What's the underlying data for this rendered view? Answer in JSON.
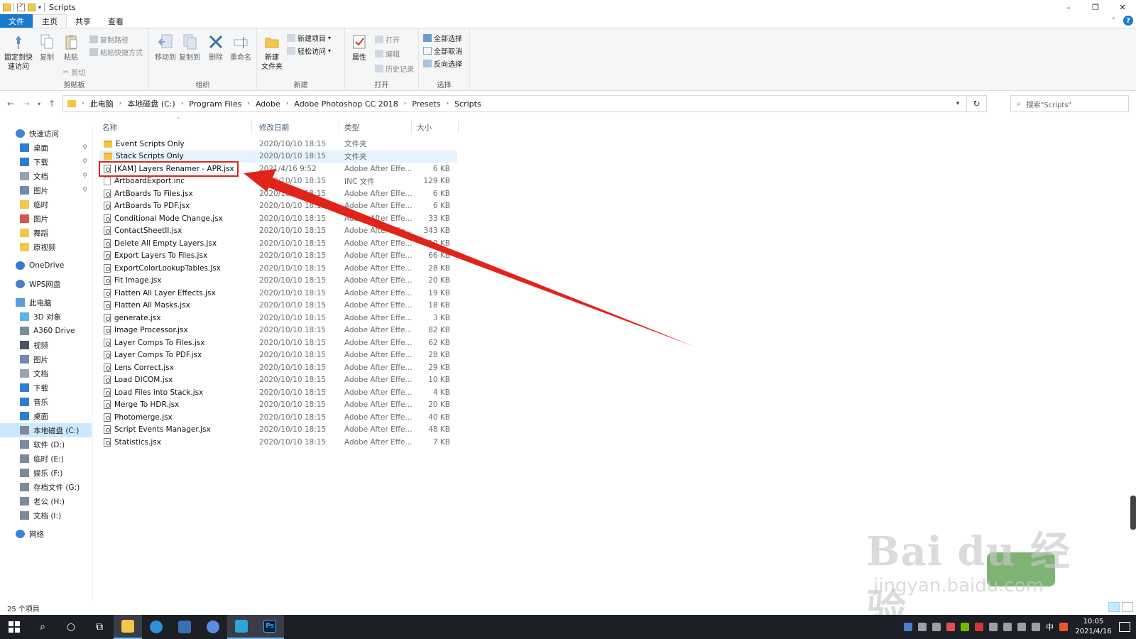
{
  "window": {
    "title": "Scripts",
    "controls": [
      "–",
      "❐",
      "✕"
    ]
  },
  "ribbon_tabs": [
    "文件",
    "主页",
    "共享",
    "查看"
  ],
  "ribbon": {
    "clipboard": {
      "label": "剪贴板",
      "pin": "固定到快速访问",
      "copy": "复制",
      "paste": "粘贴",
      "copy_path": "复制路径",
      "paste_shortcut": "粘贴快捷方式",
      "cut": "剪切"
    },
    "organize": {
      "label": "组织",
      "move_to": "移动到",
      "copy_to": "复制到",
      "delete": "删除",
      "rename": "重命名"
    },
    "new": {
      "label": "新建",
      "new_folder": "新建\n文件夹",
      "new_item": "新建项目",
      "easy_access": "轻松访问"
    },
    "open": {
      "label": "打开",
      "properties": "属性",
      "open": "打开",
      "edit": "编辑",
      "history": "历史记录"
    },
    "select": {
      "label": "选择",
      "select_all": "全部选择",
      "select_none": "全部取消",
      "invert": "反向选择"
    }
  },
  "breadcrumb": [
    "此电脑",
    "本地磁盘 (C:)",
    "Program Files",
    "Adobe",
    "Adobe Photoshop CC 2018",
    "Presets",
    "Scripts"
  ],
  "search": {
    "placeholder": "搜索\"Scripts\""
  },
  "sidebar": [
    {
      "label": "快速访问",
      "icon": "star-icon",
      "level": 0
    },
    {
      "label": "桌面",
      "icon": "desktop-icon",
      "level": 1,
      "pinned": true
    },
    {
      "label": "下载",
      "icon": "download-icon",
      "level": 1,
      "pinned": true
    },
    {
      "label": "文档",
      "icon": "document-icon",
      "level": 1,
      "pinned": true
    },
    {
      "label": "图片",
      "icon": "pictures-icon",
      "level": 1,
      "pinned": true
    },
    {
      "label": "临时",
      "icon": "folder-icon",
      "level": 1
    },
    {
      "label": "图片",
      "icon": "photos-app-icon",
      "level": 1
    },
    {
      "label": "舞蹈",
      "icon": "folder-icon",
      "level": 1
    },
    {
      "label": "原视频",
      "icon": "folder-icon",
      "level": 1
    },
    {
      "label": "OneDrive",
      "icon": "cloud-icon",
      "level": 0
    },
    {
      "label": "WPS网盘",
      "icon": "wps-cloud-icon",
      "level": 0
    },
    {
      "label": "此电脑",
      "icon": "computer-icon",
      "level": 0
    },
    {
      "label": "3D 对象",
      "icon": "cube-icon",
      "level": 1
    },
    {
      "label": "A360 Drive",
      "icon": "cloud-drive-icon",
      "level": 1
    },
    {
      "label": "视频",
      "icon": "video-icon",
      "level": 1
    },
    {
      "label": "图片",
      "icon": "pictures-icon",
      "level": 1
    },
    {
      "label": "文档",
      "icon": "document-icon",
      "level": 1
    },
    {
      "label": "下载",
      "icon": "download-icon",
      "level": 1
    },
    {
      "label": "音乐",
      "icon": "music-icon",
      "level": 1
    },
    {
      "label": "桌面",
      "icon": "desktop-icon",
      "level": 1
    },
    {
      "label": "本地磁盘 (C:)",
      "icon": "system-drive-icon",
      "level": 1,
      "selected": true
    },
    {
      "label": "软件 (D:)",
      "icon": "drive-icon",
      "level": 1
    },
    {
      "label": "临时 (E:)",
      "icon": "drive-icon",
      "level": 1
    },
    {
      "label": "娱乐 (F:)",
      "icon": "drive-icon",
      "level": 1
    },
    {
      "label": "存档文件 (G:)",
      "icon": "drive-icon",
      "level": 1
    },
    {
      "label": "老公 (H:)",
      "icon": "drive-icon",
      "level": 1
    },
    {
      "label": "文档 (I:)",
      "icon": "drive-icon",
      "level": 1
    },
    {
      "label": "网络",
      "icon": "network-icon",
      "level": 0
    }
  ],
  "columns": {
    "name": "名称",
    "date": "修改日期",
    "type": "类型",
    "size": "大小"
  },
  "files": [
    {
      "name": "Event Scripts Only",
      "date": "2020/10/10 18:15",
      "type": "文件夹",
      "size": "",
      "kind": "folder"
    },
    {
      "name": "Stack Scripts Only",
      "date": "2020/10/10 18:15",
      "type": "文件夹",
      "size": "",
      "kind": "folder"
    },
    {
      "name": "[KAM] Layers Renamer - APR.jsx",
      "date": "2021/4/16 9:52",
      "type": "Adobe After Effe...",
      "size": "6 KB",
      "kind": "jsx"
    },
    {
      "name": "ArtboardExport.inc",
      "date": "2020/10/10 18:15",
      "type": "INC 文件",
      "size": "129 KB",
      "kind": "blank"
    },
    {
      "name": "ArtBoards To Files.jsx",
      "date": "2020/10/10 18:15",
      "type": "Adobe After Effe...",
      "size": "6 KB",
      "kind": "jsx"
    },
    {
      "name": "ArtBoards To PDF.jsx",
      "date": "2020/10/10 18:15",
      "type": "Adobe After Effe...",
      "size": "6 KB",
      "kind": "jsx"
    },
    {
      "name": "Conditional Mode Change.jsx",
      "date": "2020/10/10 18:15",
      "type": "Adobe After Effe...",
      "size": "33 KB",
      "kind": "jsx"
    },
    {
      "name": "ContactSheetII.jsx",
      "date": "2020/10/10 18:15",
      "type": "Adobe After Effe...",
      "size": "343 KB",
      "kind": "jsx"
    },
    {
      "name": "Delete All Empty Layers.jsx",
      "date": "2020/10/10 18:15",
      "type": "Adobe After Effe...",
      "size": "10 KB",
      "kind": "jsx"
    },
    {
      "name": "Export Layers To Files.jsx",
      "date": "2020/10/10 18:15",
      "type": "Adobe After Effe...",
      "size": "66 KB",
      "kind": "jsx"
    },
    {
      "name": "ExportColorLookupTables.jsx",
      "date": "2020/10/10 18:15",
      "type": "Adobe After Effe...",
      "size": "28 KB",
      "kind": "jsx"
    },
    {
      "name": "Fit Image.jsx",
      "date": "2020/10/10 18:15",
      "type": "Adobe After Effe...",
      "size": "20 KB",
      "kind": "jsx"
    },
    {
      "name": "Flatten All Layer Effects.jsx",
      "date": "2020/10/10 18:15",
      "type": "Adobe After Effe...",
      "size": "19 KB",
      "kind": "jsx"
    },
    {
      "name": "Flatten All Masks.jsx",
      "date": "2020/10/10 18:15",
      "type": "Adobe After Effe...",
      "size": "18 KB",
      "kind": "jsx"
    },
    {
      "name": "generate.jsx",
      "date": "2020/10/10 18:15",
      "type": "Adobe After Effe...",
      "size": "3 KB",
      "kind": "jsx"
    },
    {
      "name": "Image Processor.jsx",
      "date": "2020/10/10 18:15",
      "type": "Adobe After Effe...",
      "size": "82 KB",
      "kind": "jsx"
    },
    {
      "name": "Layer Comps To Files.jsx",
      "date": "2020/10/10 18:15",
      "type": "Adobe After Effe...",
      "size": "62 KB",
      "kind": "jsx"
    },
    {
      "name": "Layer Comps To PDF.jsx",
      "date": "2020/10/10 18:15",
      "type": "Adobe After Effe...",
      "size": "28 KB",
      "kind": "jsx"
    },
    {
      "name": "Lens Correct.jsx",
      "date": "2020/10/10 18:15",
      "type": "Adobe After Effe...",
      "size": "29 KB",
      "kind": "jsx"
    },
    {
      "name": "Load DICOM.jsx",
      "date": "2020/10/10 18:15",
      "type": "Adobe After Effe...",
      "size": "10 KB",
      "kind": "jsx"
    },
    {
      "name": "Load Files into Stack.jsx",
      "date": "2020/10/10 18:15",
      "type": "Adobe After Effe...",
      "size": "4 KB",
      "kind": "jsx"
    },
    {
      "name": "Merge To HDR.jsx",
      "date": "2020/10/10 18:15",
      "type": "Adobe After Effe...",
      "size": "20 KB",
      "kind": "jsx"
    },
    {
      "name": "Photomerge.jsx",
      "date": "2020/10/10 18:15",
      "type": "Adobe After Effe...",
      "size": "40 KB",
      "kind": "jsx"
    },
    {
      "name": "Script Events Manager.jsx",
      "date": "2020/10/10 18:15",
      "type": "Adobe After Effe...",
      "size": "48 KB",
      "kind": "jsx"
    },
    {
      "name": "Statistics.jsx",
      "date": "2020/10/10 18:15",
      "type": "Adobe After Effe...",
      "size": "7 KB",
      "kind": "jsx"
    }
  ],
  "status": {
    "count": "25 个项目"
  },
  "taskbar": {
    "apps": [
      "start-icon",
      "search-icon",
      "cortana-icon",
      "task-view-icon",
      "file-explorer-icon",
      "edge-icon",
      "app-icon",
      "baidu-netdisk-icon",
      "app-icon",
      "photoshop-icon"
    ],
    "photoshop_label": "Ps",
    "ime": "中",
    "time": "10:05",
    "date": "2021/4/16"
  },
  "watermark": {
    "big": "Bai du 经验",
    "small": "jingyan.baidu.com"
  },
  "colors": {
    "accent": "#1979ca",
    "annotation": "#e2231a",
    "selection": "#cce8ff",
    "taskbar": "#1c1f26"
  }
}
